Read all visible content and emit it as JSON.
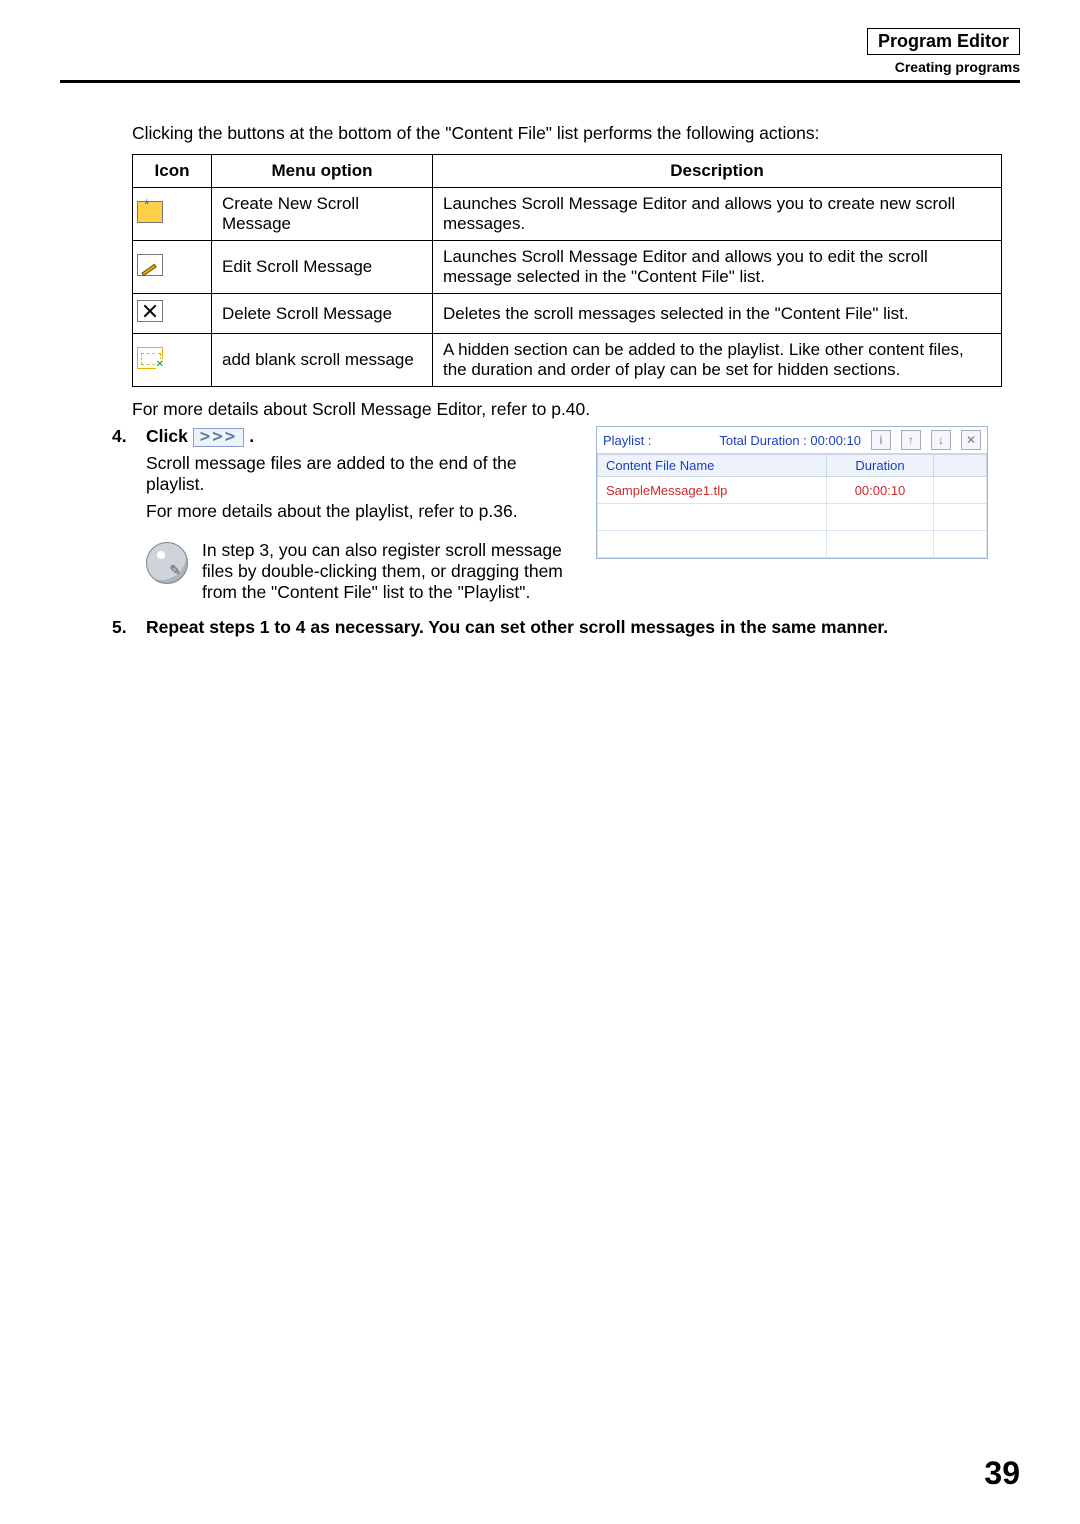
{
  "header": {
    "title": "Program Editor",
    "subtitle": "Creating programs"
  },
  "intro": "Clicking the buttons at the bottom of the \"Content File\" list performs the following actions:",
  "table": {
    "headers": {
      "icon": "Icon",
      "menu": "Menu option",
      "desc": "Description"
    },
    "rows": [
      {
        "menu": "Create New Scroll Message",
        "desc": "Launches Scroll Message Editor and allows you to create new scroll messages."
      },
      {
        "menu": "Edit Scroll Message",
        "desc": "Launches Scroll Message Editor and allows you to edit the scroll message selected in the \"Content File\" list."
      },
      {
        "menu": "Delete Scroll Message",
        "desc": "Deletes the scroll messages selected in the \"Content File\" list."
      },
      {
        "menu": "add blank scroll message",
        "desc": "A hidden section can be added to the playlist. Like other content files, the duration and order of play can be set for hidden sections."
      }
    ]
  },
  "below": "For more details about Scroll Message Editor, refer to p.40.",
  "step4": {
    "head_pre": "Click",
    "head_post": ".",
    "body1": "Scroll message files are added to the end of the playlist.",
    "body2": "For more details about the playlist, refer to p.36."
  },
  "note": "In step 3, you can also register scroll message files by double-clicking them, or dragging them from the \"Content File\" list to the \"Playlist\".",
  "step5": "Repeat steps 1 to 4 as necessary. You can set other scroll messages in the same manner.",
  "playlist": {
    "label": "Playlist :",
    "total": "Total Duration : 00:00:10",
    "cols": {
      "name": "Content File Name",
      "dur": "Duration"
    },
    "rows": [
      {
        "name": "SampleMessage1.tlp",
        "dur": "00:00:10"
      }
    ],
    "btn_arrows": ">>>"
  },
  "page_number": "39"
}
